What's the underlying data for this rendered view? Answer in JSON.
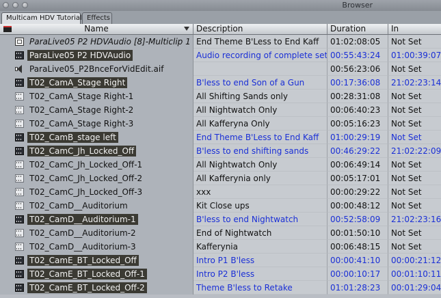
{
  "window": {
    "title": "Browser"
  },
  "tabs": [
    {
      "label": "Multicam HDV Tutorial",
      "active": true
    },
    {
      "label": "Effects",
      "active": false
    }
  ],
  "columns": {
    "name": "Name",
    "description": "Description",
    "duration": "Duration",
    "in": "In"
  },
  "rows": [
    {
      "name": "ParaLive05 P2 HDVAudio [8]-Multiclip 1",
      "icon": "sequence-icon",
      "highlight": false,
      "italic": true,
      "blue": false,
      "description": "End Theme B'Less to End Kaff",
      "duration": "01:02:08:05",
      "in": "Not Set"
    },
    {
      "name": "ParaLive05 P2 HDVAudio",
      "icon": "clip-icon",
      "highlight": true,
      "italic": false,
      "blue": true,
      "description": "Audio recording of complete set",
      "duration": "00:55:43:24",
      "in": "01:00:39:07"
    },
    {
      "name": "ParaLive05_P2BnceForVidEdit.aif",
      "icon": "audio-icon",
      "highlight": false,
      "italic": false,
      "blue": false,
      "description": "",
      "duration": "00:56:23:06",
      "in": "Not Set"
    },
    {
      "name": "T02_CamA_Stage Right",
      "icon": "clip-icon",
      "highlight": true,
      "italic": false,
      "blue": true,
      "description": "B'less to end Son of a Gun",
      "duration": "00:17:36:08",
      "in": "21:02:23:14"
    },
    {
      "name": "T02_CamA_Stage Right-1",
      "icon": "clip-icon",
      "highlight": false,
      "italic": false,
      "blue": false,
      "description": "All Shifting Sands only",
      "duration": "00:28:31:08",
      "in": "Not Set"
    },
    {
      "name": "T02_CamA_Stage Right-2",
      "icon": "clip-icon",
      "highlight": false,
      "italic": false,
      "blue": false,
      "description": "All Nightwatch Only",
      "duration": "00:06:40:23",
      "in": "Not Set"
    },
    {
      "name": "T02_CamA_Stage Right-3",
      "icon": "clip-icon",
      "highlight": false,
      "italic": false,
      "blue": false,
      "description": "All Kafferyna Only",
      "duration": "00:05:16:23",
      "in": "Not Set"
    },
    {
      "name": "T02_CamB_stage left",
      "icon": "clip-icon",
      "highlight": true,
      "italic": false,
      "blue": true,
      "description": "End Theme B'Less to End Kaff",
      "duration": "01:00:29:19",
      "in": "Not Set"
    },
    {
      "name": "T02_CamC_Jh_Locked_Off",
      "icon": "clip-icon",
      "highlight": true,
      "italic": false,
      "blue": true,
      "description": "B'less to end shifting sands",
      "duration": "00:46:29:22",
      "in": "21:02:22:09"
    },
    {
      "name": "T02_CamC_Jh_Locked_Off-1",
      "icon": "clip-icon",
      "highlight": false,
      "italic": false,
      "blue": false,
      "description": "All Nightwatch Only",
      "duration": "00:06:49:14",
      "in": "Not Set"
    },
    {
      "name": "T02_CamC_Jh_Locked_Off-2",
      "icon": "clip-icon",
      "highlight": false,
      "italic": false,
      "blue": false,
      "description": "All Kafferynia only",
      "duration": "00:05:17:01",
      "in": "Not Set"
    },
    {
      "name": "T02_CamC_Jh_Locked_Off-3",
      "icon": "clip-icon",
      "highlight": false,
      "italic": false,
      "blue": false,
      "description": "xxx",
      "duration": "00:00:29:22",
      "in": "Not Set"
    },
    {
      "name": "T02_CamD__Auditorium",
      "icon": "clip-icon",
      "highlight": false,
      "italic": false,
      "blue": false,
      "description": "Kit Close ups",
      "duration": "00:00:48:12",
      "in": "Not Set"
    },
    {
      "name": "T02_CamD__Auditorium-1",
      "icon": "clip-icon",
      "highlight": true,
      "italic": false,
      "blue": true,
      "description": "B'less to end Nightwatch",
      "duration": "00:52:58:09",
      "in": "21:02:23:16"
    },
    {
      "name": "T02_CamD__Auditorium-2",
      "icon": "clip-icon",
      "highlight": false,
      "italic": false,
      "blue": false,
      "description": "End of Nightwatch",
      "duration": "00:01:50:10",
      "in": "Not Set"
    },
    {
      "name": "T02_CamD__Auditorium-3",
      "icon": "clip-icon",
      "highlight": false,
      "italic": false,
      "blue": false,
      "description": "Kafferynia",
      "duration": "00:06:48:15",
      "in": "Not Set"
    },
    {
      "name": "T02_CamE_BT_Locked_Off",
      "icon": "clip-icon",
      "highlight": true,
      "italic": false,
      "blue": true,
      "description": "Intro P1  B'less",
      "duration": "00:00:41:10",
      "in": "00:00:21:12"
    },
    {
      "name": "T02_CamE_BT_Locked_Off-1",
      "icon": "clip-icon",
      "highlight": true,
      "italic": false,
      "blue": true,
      "description": "Intro P2  B'less",
      "duration": "00:00:10:17",
      "in": "00:01:10:11"
    },
    {
      "name": "T02_CamE_BT_Locked_Off-2",
      "icon": "clip-icon",
      "highlight": true,
      "italic": false,
      "blue": true,
      "description": "Theme B'less to Retake",
      "duration": "01:01:28:23",
      "in": "00:01:29:04"
    }
  ]
}
